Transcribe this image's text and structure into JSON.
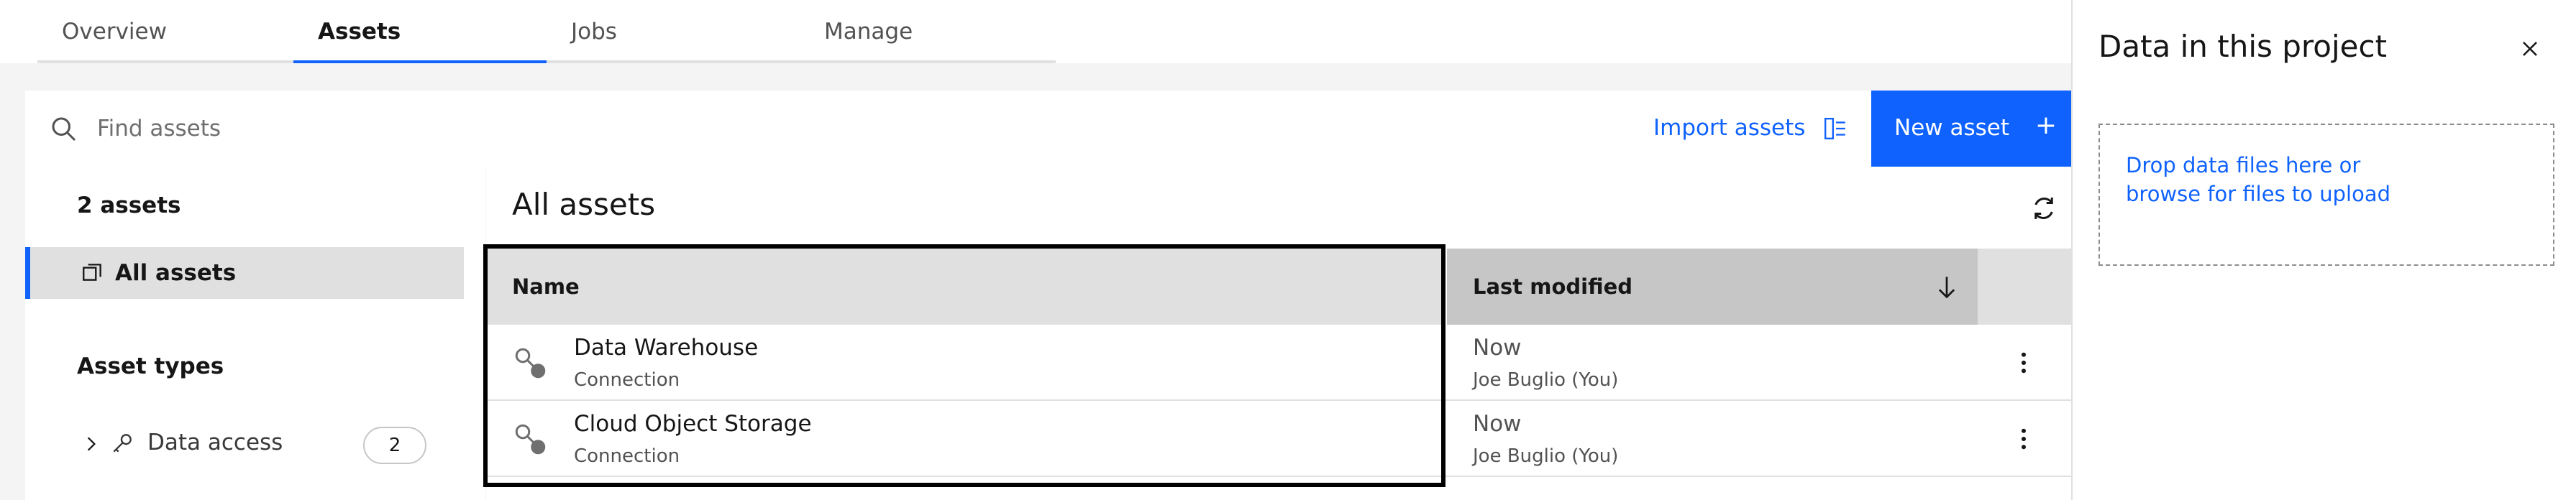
{
  "tabs": [
    {
      "label": "Overview",
      "active": false
    },
    {
      "label": "Assets",
      "active": true
    },
    {
      "label": "Jobs",
      "active": false
    },
    {
      "label": "Manage",
      "active": false
    }
  ],
  "toolbar": {
    "search_placeholder": "Find assets",
    "import_label": "Import assets",
    "new_asset_label": "New asset",
    "new_asset_icon": "+"
  },
  "sidebar": {
    "asset_count": "2 assets",
    "all_assets_label": "All assets",
    "asset_types_heading": "Asset types",
    "data_access_label": "Data access",
    "data_access_count": "2"
  },
  "main": {
    "title": "All assets",
    "columns": {
      "name": "Name",
      "last_modified": "Last modified"
    },
    "rows": [
      {
        "name": "Data Warehouse",
        "type": "Connection",
        "modified": "Now",
        "by": "Joe Buglio (You)"
      },
      {
        "name": "Cloud Object Storage",
        "type": "Connection",
        "modified": "Now",
        "by": "Joe Buglio (You)"
      }
    ]
  },
  "panel": {
    "title": "Data in this project",
    "drop_line1": "Drop data files here or",
    "drop_line2": "browse for files to upload"
  },
  "colors": {
    "accent": "#0f62fe",
    "background": "#f4f4f4",
    "header_bg": "#e0e0e0",
    "sorted_header_bg": "#c6c6c6"
  },
  "icons": {
    "search": "search-icon",
    "import": "import-icon",
    "refresh": "refresh-icon",
    "close": "close-icon",
    "sort": "arrow-down-icon",
    "connection": "connection-icon",
    "overflow": "overflow-menu-icon"
  }
}
